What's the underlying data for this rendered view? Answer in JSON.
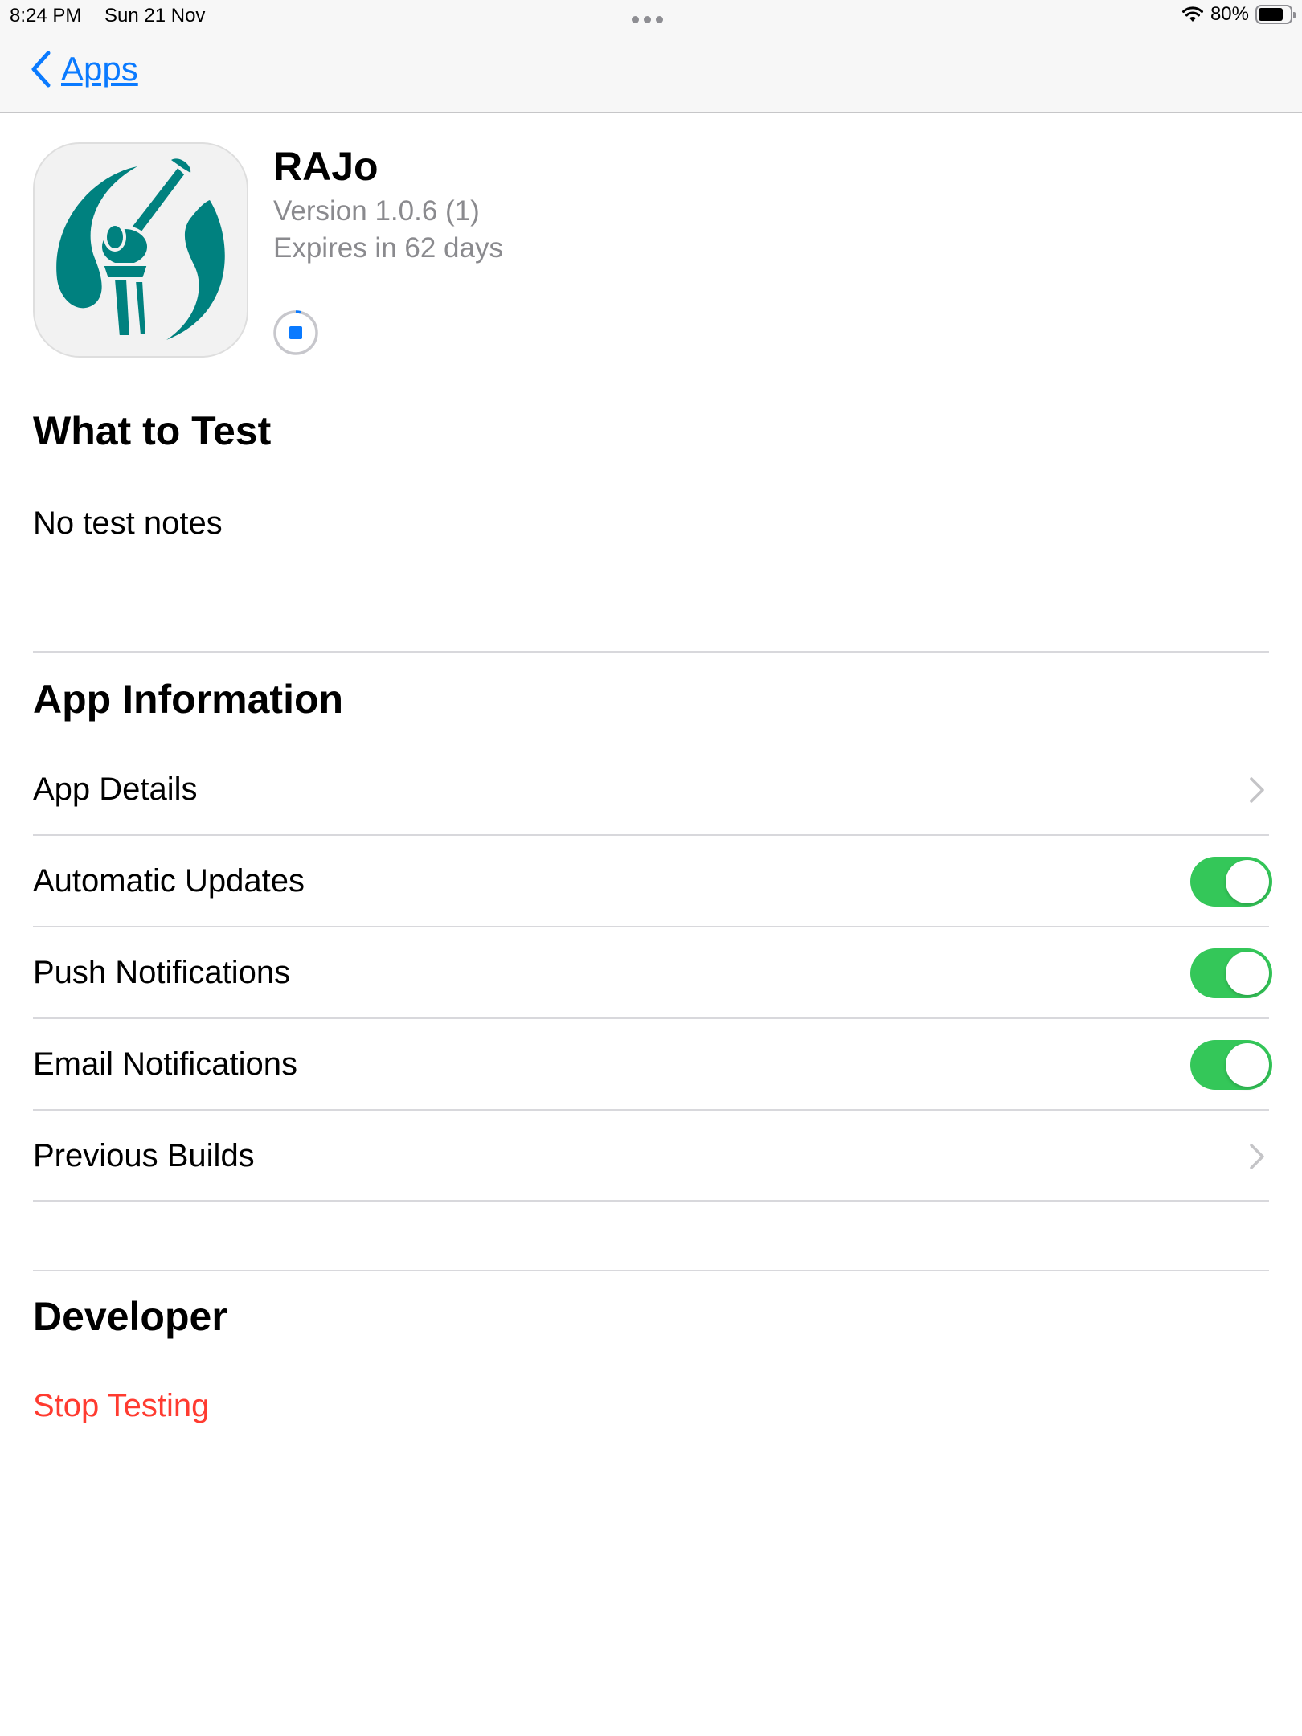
{
  "status_bar": {
    "time": "8:24 PM",
    "date": "Sun 21 Nov",
    "battery": "80%",
    "battery_level": 0.8
  },
  "nav": {
    "back_label": "Apps",
    "back_icon": "chevron-left-icon"
  },
  "app": {
    "name": "RAJo",
    "version": "Version 1.0.6 (1)",
    "expires": "Expires in 62 days",
    "icon": "knee-joint-app-icon",
    "icon_color": "#00817f"
  },
  "sections": {
    "what_to_test": {
      "title": "What to Test",
      "notes": "No test notes"
    },
    "app_information": {
      "title": "App Information",
      "rows": [
        {
          "label": "App Details",
          "type": "disclosure"
        },
        {
          "label": "Automatic Updates",
          "type": "toggle",
          "on": true
        },
        {
          "label": "Push Notifications",
          "type": "toggle",
          "on": true
        },
        {
          "label": "Email Notifications",
          "type": "toggle",
          "on": true
        },
        {
          "label": "Previous Builds",
          "type": "disclosure"
        }
      ]
    },
    "developer": {
      "title": "Developer",
      "stop_label": "Stop Testing"
    }
  },
  "colors": {
    "accent": "#0a7aff",
    "toggle_on": "#34c759",
    "destructive": "#ff3b30",
    "secondary_text": "#8a8a8e"
  }
}
